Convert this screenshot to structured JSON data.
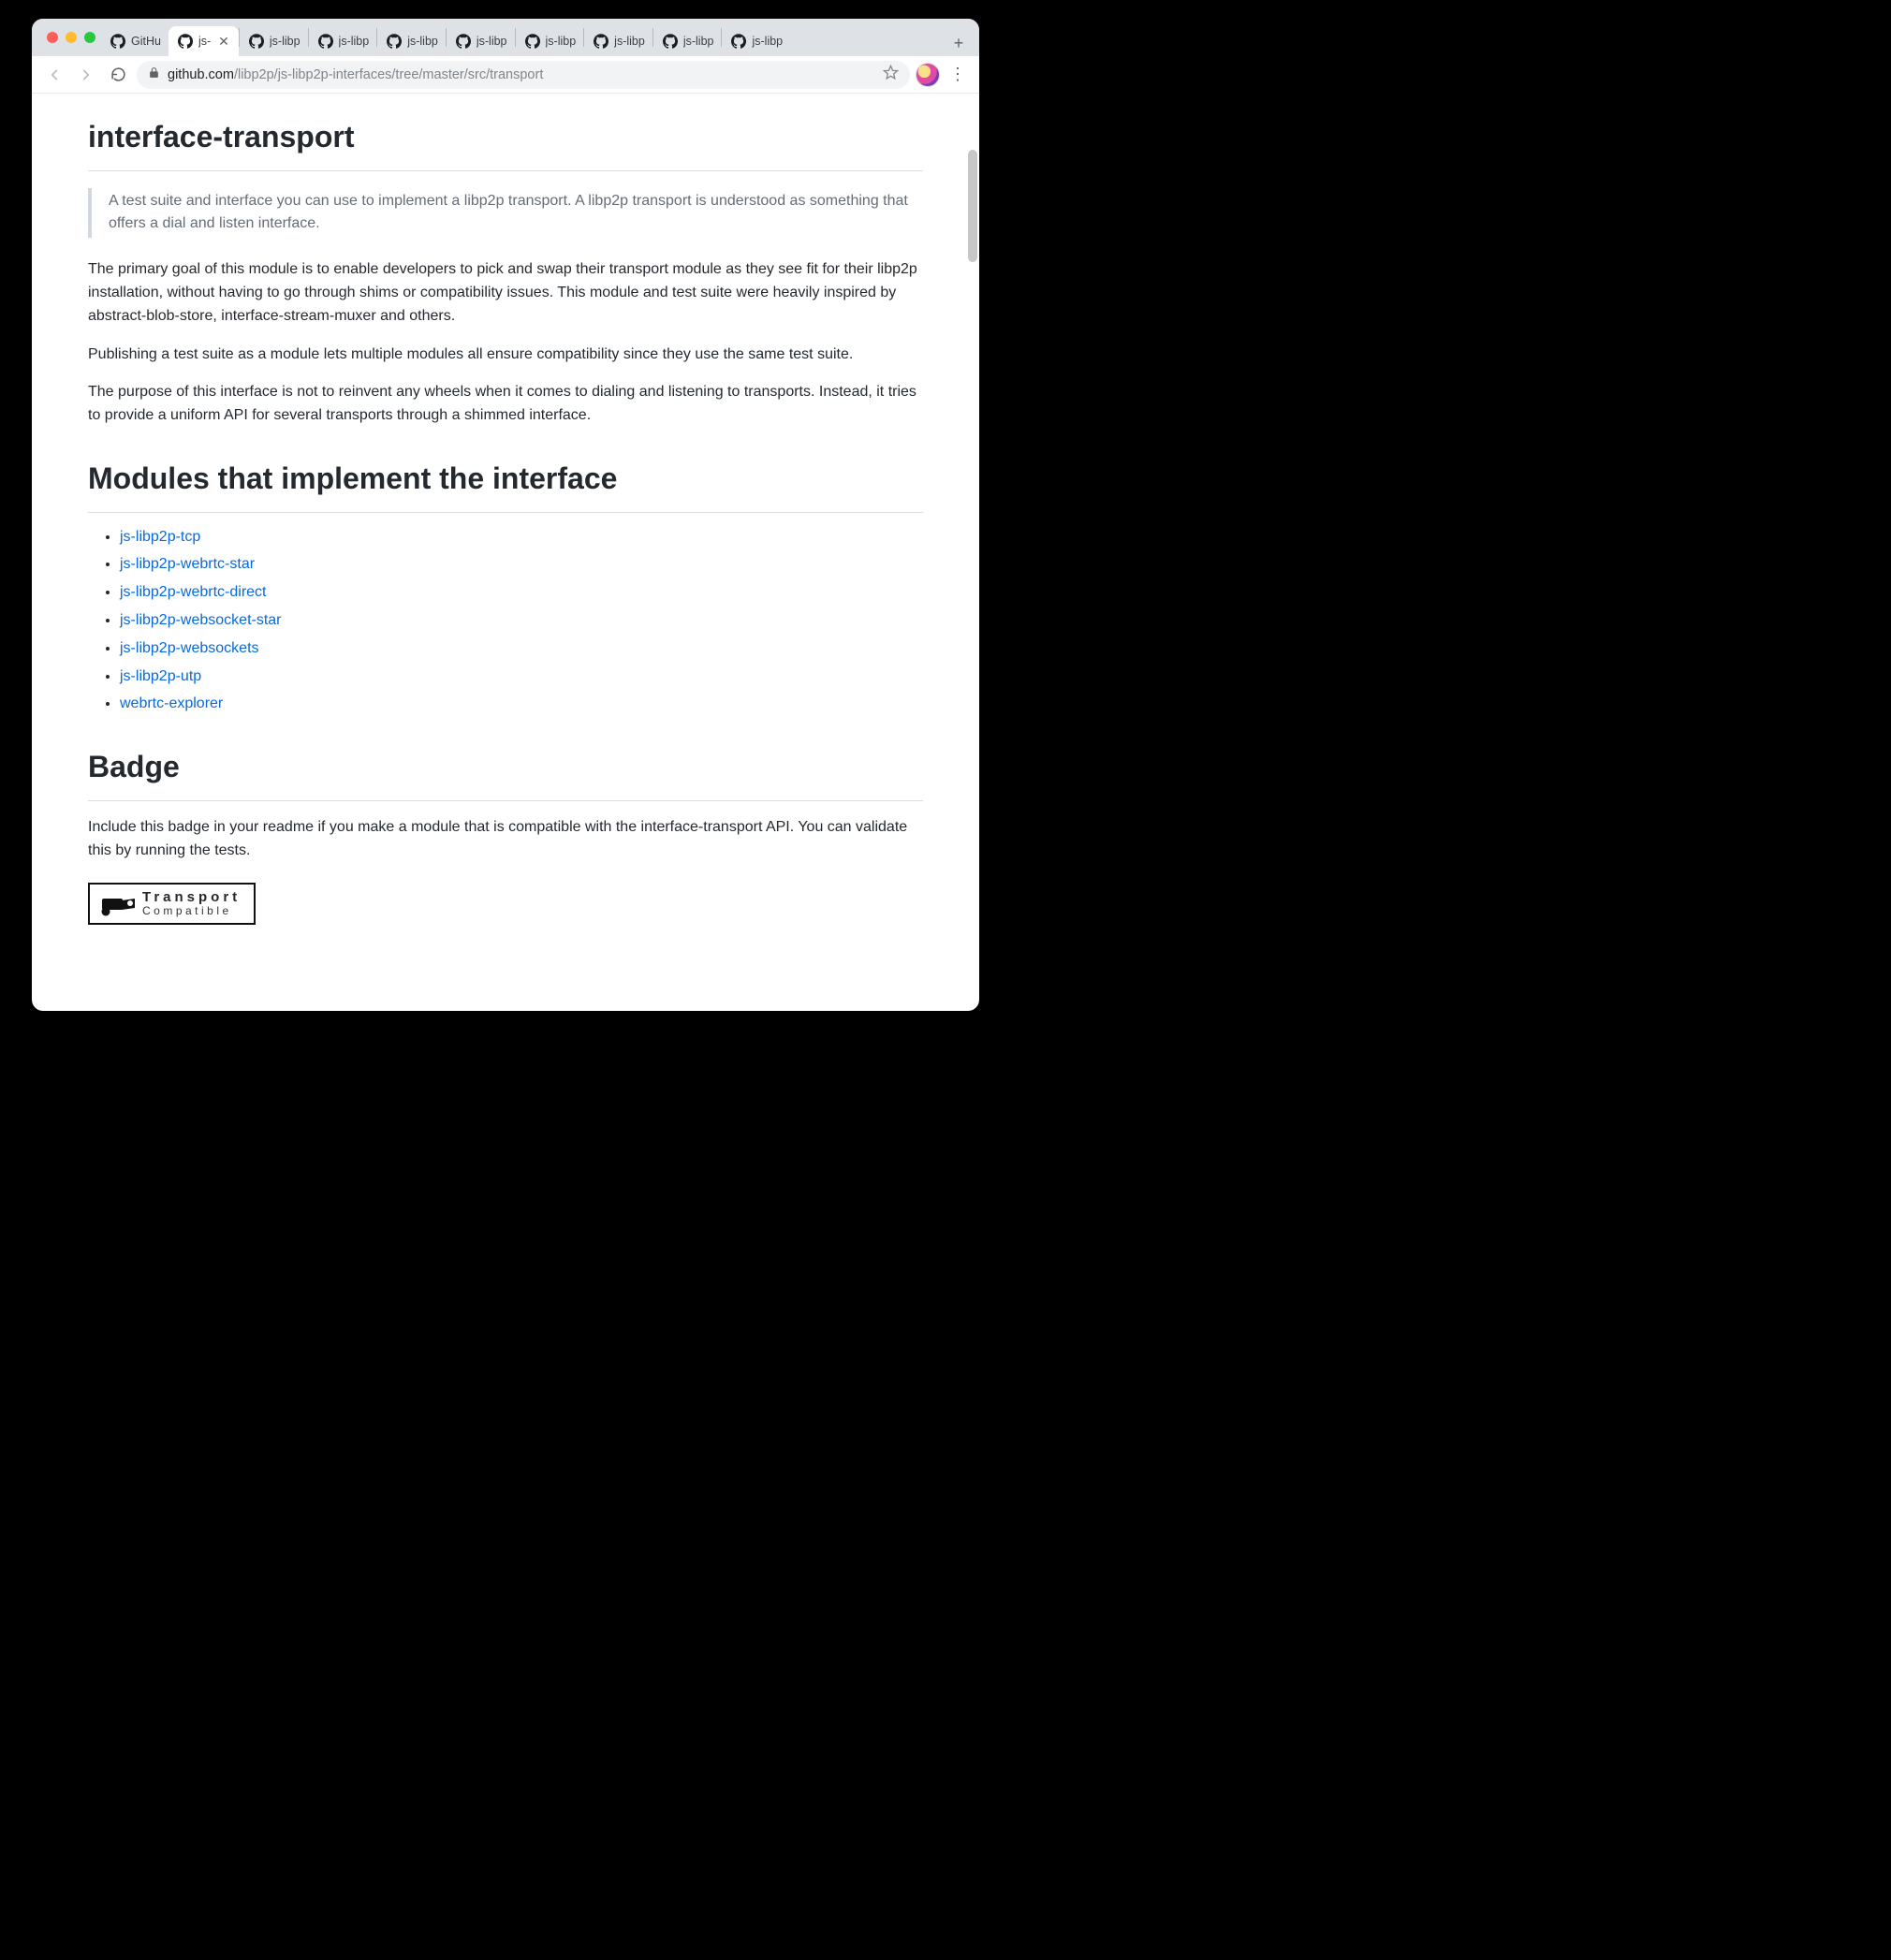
{
  "browser": {
    "url_host": "github.com",
    "url_path": "/libp2p/js-libp2p-interfaces/tree/master/src/transport",
    "tabs": [
      {
        "label": "GitHu",
        "active": false,
        "close": false
      },
      {
        "label": "js-",
        "active": true,
        "close": true
      },
      {
        "label": "js-libp",
        "active": false,
        "close": false
      },
      {
        "label": "js-libp",
        "active": false,
        "close": false
      },
      {
        "label": "js-libp",
        "active": false,
        "close": false
      },
      {
        "label": "js-libp",
        "active": false,
        "close": false
      },
      {
        "label": "js-libp",
        "active": false,
        "close": false
      },
      {
        "label": "js-libp",
        "active": false,
        "close": false
      },
      {
        "label": "js-libp",
        "active": false,
        "close": false
      },
      {
        "label": "js-libp",
        "active": false,
        "close": false
      }
    ]
  },
  "page": {
    "h1_title": "interface-transport",
    "quote": "A test suite and interface you can use to implement a libp2p transport. A libp2p transport is understood as something that offers a dial and listen interface.",
    "p1": "The primary goal of this module is to enable developers to pick and swap their transport module as they see fit for their libp2p installation, without having to go through shims or compatibility issues. This module and test suite were heavily inspired by abstract-blob-store, interface-stream-muxer and others.",
    "p2": "Publishing a test suite as a module lets multiple modules all ensure compatibility since they use the same test suite.",
    "p3": "The purpose of this interface is not to reinvent any wheels when it comes to dialing and listening to transports. Instead, it tries to provide a uniform API for several transports through a shimmed interface.",
    "h2_modules": "Modules that implement the interface",
    "modules": [
      "js-libp2p-tcp",
      "js-libp2p-webrtc-star",
      "js-libp2p-webrtc-direct",
      "js-libp2p-websocket-star",
      "js-libp2p-websockets",
      "js-libp2p-utp",
      "webrtc-explorer"
    ],
    "h2_badge": "Badge",
    "badge_p": "Include this badge in your readme if you make a module that is compatible with the interface-transport API. You can validate this by running the tests.",
    "badge_top": "Transport",
    "badge_bottom": "Compatible"
  }
}
